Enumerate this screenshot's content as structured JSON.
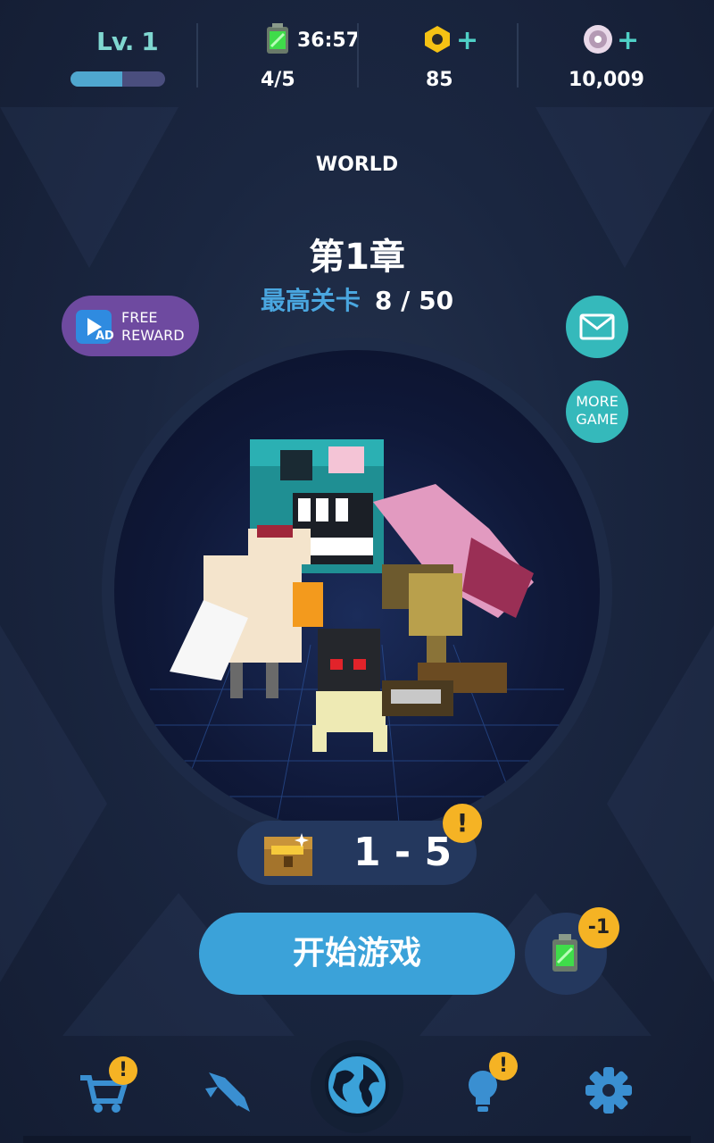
{
  "top": {
    "level_label": "Lv. 1",
    "level_progress": 0.55,
    "energy_timer": "36:57",
    "energy_count": "4/5",
    "coins": "85",
    "gems": "10,009",
    "plus": "+"
  },
  "world_label": "WORLD",
  "chapter_title": "第1章",
  "best_stage": {
    "label": "最高关卡",
    "value": "8 / 50"
  },
  "free_reward": {
    "ad": "AD",
    "line1": "FREE",
    "line2": "REWARD"
  },
  "more_game": {
    "line1": "MORE",
    "line2": "GAME"
  },
  "stage": "1 - 5",
  "alert_mark": "!",
  "start_button": "开始游戏",
  "energy_cost": "-1",
  "colors": {
    "accent": "#3ba2d9",
    "teal": "#35b9bb",
    "alert": "#f5b324",
    "purple": "#6e4aa0"
  },
  "nav": [
    "cart-icon",
    "rocket-icon",
    "globe-icon",
    "lightbulb-icon",
    "gear-icon"
  ]
}
